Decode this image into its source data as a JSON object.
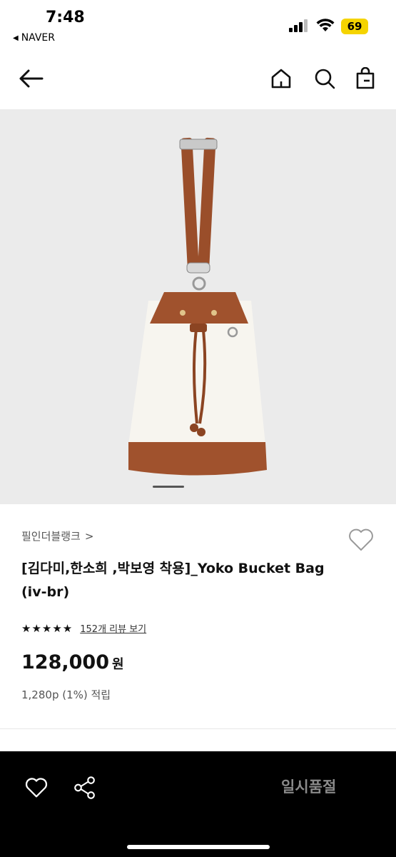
{
  "status_bar": {
    "time": "7:48",
    "back_app": "NAVER",
    "battery": "69"
  },
  "nav": {
    "icons": [
      "back-arrow-icon",
      "home-icon",
      "search-icon",
      "shopping-bag-icon"
    ]
  },
  "product": {
    "image_count_indicator": "carousel",
    "brand": "필인더블랭크",
    "brand_chevron": ">",
    "title": "[김다미,한소희 ,박보영 착용]_Yoko Bucket Bag (iv-br)",
    "stars": "★★★★★",
    "reviews": "152개 리뷰 보기",
    "price": "128,000",
    "currency": "원",
    "points": "1,280p (1%) 적립"
  },
  "bottom_bar": {
    "status_label": "일시품절"
  },
  "colors": {
    "leather": "#a0522d",
    "canvas": "#f7f5ef",
    "bottom_bar": "#000000",
    "soldout_text": "#8a8a8a"
  }
}
